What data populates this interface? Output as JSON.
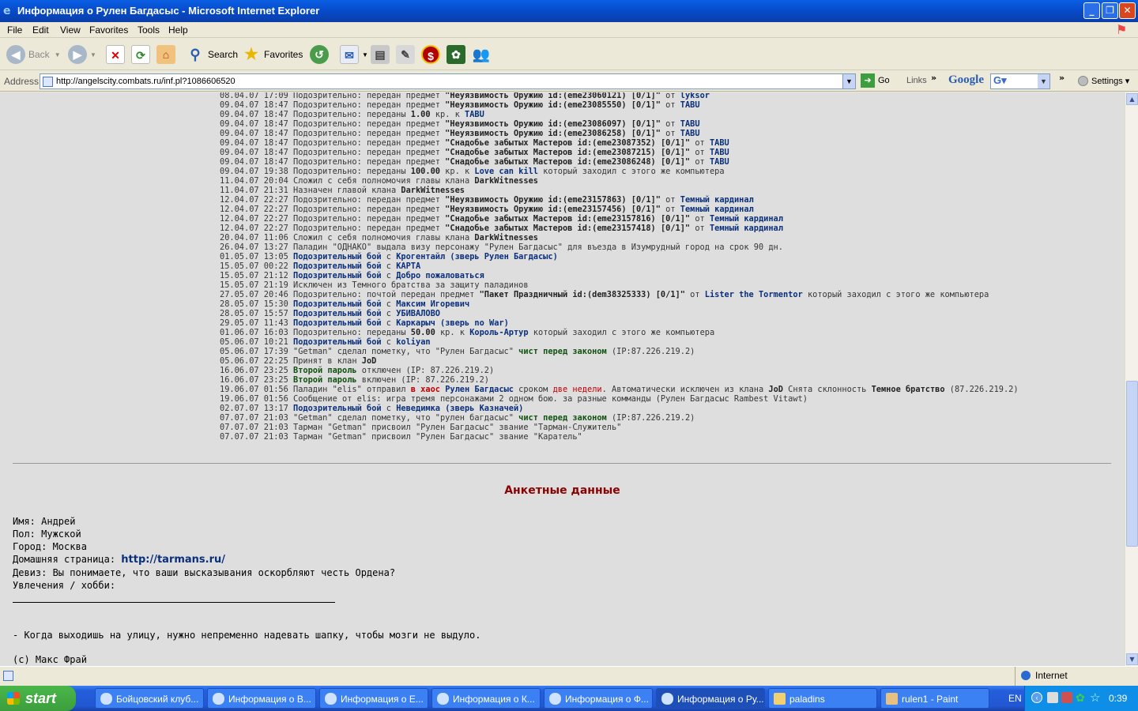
{
  "window": {
    "title": "Информация о Рулен Багдасыс - Microsoft Internet Explorer"
  },
  "menu": [
    "File",
    "Edit",
    "View",
    "Favorites",
    "Tools",
    "Help"
  ],
  "toolbar": {
    "back": "Back",
    "search": "Search",
    "favorites": "Favorites"
  },
  "address": {
    "label": "Address",
    "url": "http://angelscity.combats.ru/inf.pl?1086606520",
    "go": "Go",
    "links": "Links",
    "google": "Google",
    "settings": "Settings"
  },
  "log": [
    [
      [
        "",
        "08.04.07 17:09 Подозрительно: передан предмет "
      ],
      [
        "b",
        "\"Неуязвимость Оружию id:(eme23060121) [0/1]\""
      ],
      [
        "",
        " от "
      ],
      [
        "lk",
        "lyksor"
      ]
    ],
    [
      [
        "",
        "09.04.07 18:47 Подозрительно: передан предмет "
      ],
      [
        "b",
        "\"Неуязвимость Оружию id:(eme23085550) [0/1]\""
      ],
      [
        "",
        " от "
      ],
      [
        "lk",
        "TABU"
      ]
    ],
    [
      [
        "",
        "09.04.07 18:47 Подозрительно: переданы "
      ],
      [
        "b",
        "1.00"
      ],
      [
        "",
        " кр. к "
      ],
      [
        "lk",
        "TABU"
      ]
    ],
    [
      [
        "",
        "09.04.07 18:47 Подозрительно: передан предмет "
      ],
      [
        "b",
        "\"Неуязвимость Оружию id:(eme23086097) [0/1]\""
      ],
      [
        "",
        " от "
      ],
      [
        "lk",
        "TABU"
      ]
    ],
    [
      [
        "",
        "09.04.07 18:47 Подозрительно: передан предмет "
      ],
      [
        "b",
        "\"Неуязвимость Оружию id:(eme23086258) [0/1]\""
      ],
      [
        "",
        " от "
      ],
      [
        "lk",
        "TABU"
      ]
    ],
    [
      [
        "",
        "09.04.07 18:47 Подозрительно: передан предмет "
      ],
      [
        "b",
        "\"Снадобье забытых Мастеров id:(eme23087352) [0/1]\""
      ],
      [
        "",
        " от "
      ],
      [
        "lk",
        "TABU"
      ]
    ],
    [
      [
        "",
        "09.04.07 18:47 Подозрительно: передан предмет "
      ],
      [
        "b",
        "\"Снадобье забытых Мастеров id:(eme23087215) [0/1]\""
      ],
      [
        "",
        " от "
      ],
      [
        "lk",
        "TABU"
      ]
    ],
    [
      [
        "",
        "09.04.07 18:47 Подозрительно: передан предмет "
      ],
      [
        "b",
        "\"Снадобье забытых Мастеров id:(eme23086248) [0/1]\""
      ],
      [
        "",
        " от "
      ],
      [
        "lk",
        "TABU"
      ]
    ],
    [
      [
        "",
        "09.04.07 19:38 Подозрительно: переданы "
      ],
      [
        "b",
        "100.00"
      ],
      [
        "",
        " кр. к "
      ],
      [
        "lk",
        "Love can kill"
      ],
      [
        "",
        " который заходил с этого же компьютера"
      ]
    ],
    [
      [
        "",
        "11.04.07 20:04 Сложил с себя полномочия главы клана "
      ],
      [
        "b",
        "DarkWitnesses"
      ]
    ],
    [
      [
        "",
        "11.04.07 21:31 Назначен главой клана "
      ],
      [
        "b",
        "DarkWitnesses"
      ]
    ],
    [
      [
        "",
        "12.04.07 22:27 Подозрительно: передан предмет "
      ],
      [
        "b",
        "\"Неуязвимость Оружию id:(eme23157863) [0/1]\""
      ],
      [
        "",
        " от "
      ],
      [
        "lk",
        "Темный кардинал"
      ]
    ],
    [
      [
        "",
        "12.04.07 22:27 Подозрительно: передан предмет "
      ],
      [
        "b",
        "\"Неуязвимость Оружию id:(eme23157456) [0/1]\""
      ],
      [
        "",
        " от "
      ],
      [
        "lk",
        "Темный кардинал"
      ]
    ],
    [
      [
        "",
        "12.04.07 22:27 Подозрительно: передан предмет "
      ],
      [
        "b",
        "\"Снадобье забытых Мастеров id:(eme23157816) [0/1]\""
      ],
      [
        "",
        " от "
      ],
      [
        "lk",
        "Темный кардинал"
      ]
    ],
    [
      [
        "",
        "12.04.07 22:27 Подозрительно: передан предмет "
      ],
      [
        "b",
        "\"Снадобье забытых Мастеров id:(eme23157418) [0/1]\""
      ],
      [
        "",
        " от "
      ],
      [
        "lk",
        "Темный кардинал"
      ]
    ],
    [
      [
        "",
        "20.04.07 11:06 Сложил с себя полномочия главы клана "
      ],
      [
        "b",
        "DarkWitnesses"
      ]
    ],
    [
      [
        "",
        "26.04.07 13:27 Паладин \"ОДНАКО\" выдала визу персонажу \"Рулен Багдасыс\" для въезда в Изумрудный город на срок 90 дн."
      ]
    ],
    [
      [
        "",
        "01.05.07 13:05 "
      ],
      [
        "lk",
        "Подозрительный бой"
      ],
      [
        "",
        " с "
      ],
      [
        "lk",
        "Крогентайл (зверь Рулен Багдасыс)"
      ]
    ],
    [
      [
        "",
        "15.05.07 00:22 "
      ],
      [
        "lk",
        "Подозрительный бой"
      ],
      [
        "",
        " с "
      ],
      [
        "lk",
        "КАРТА"
      ]
    ],
    [
      [
        "",
        "15.05.07 21:12 "
      ],
      [
        "lk",
        "Подозрительный бой"
      ],
      [
        "",
        " с "
      ],
      [
        "lk",
        "Добро пожаловаться"
      ]
    ],
    [
      [
        "",
        "15.05.07 21:19 Исключен из Темного братства за защиту паладинов"
      ]
    ],
    [
      [
        "",
        "27.05.07 20:46 Подозрительно: почтой передан предмет "
      ],
      [
        "b",
        "\"Пакет Праздничный id:(dem38325333) [0/1]\""
      ],
      [
        "",
        " от "
      ],
      [
        "lk",
        "Lister the Tormentor"
      ],
      [
        "",
        " который заходил с этого же компьютера"
      ]
    ],
    [
      [
        "",
        "28.05.07 15:30 "
      ],
      [
        "lk",
        "Подозрительный бой"
      ],
      [
        "",
        " с "
      ],
      [
        "lk",
        "Максим Игоревич"
      ]
    ],
    [
      [
        "",
        "28.05.07 15:57 "
      ],
      [
        "lk",
        "Подозрительный бой"
      ],
      [
        "",
        " с "
      ],
      [
        "lk",
        "УБИВАЛОВО"
      ]
    ],
    [
      [
        "",
        "29.05.07 11:43 "
      ],
      [
        "lk",
        "Подозрительный бой"
      ],
      [
        "",
        " с "
      ],
      [
        "lk",
        "Каркарыч (зверь no War)"
      ]
    ],
    [
      [
        "",
        "01.06.07 16:03 Подозрительно: переданы "
      ],
      [
        "b",
        "50.00"
      ],
      [
        "",
        " кр. к "
      ],
      [
        "lk",
        "Король-Артур"
      ],
      [
        "",
        " который заходил с этого же компьютера"
      ]
    ],
    [
      [
        "",
        "05.06.07 10:21 "
      ],
      [
        "lk",
        "Подозрительный бой"
      ],
      [
        "",
        " с "
      ],
      [
        "lk",
        "koliyan"
      ]
    ],
    [
      [
        "",
        "05.06.07 17:39 \"Getman\" сделал пометку, что \"Рулен Багдасыс\" "
      ],
      [
        "g",
        "чист перед законом"
      ],
      [
        "",
        " (IP:87.226.219.2)"
      ]
    ],
    [
      [
        "",
        "05.06.07 22:25 Принят в клан "
      ],
      [
        "b",
        "JoD"
      ]
    ],
    [
      [
        "",
        "16.06.07 23:25 "
      ],
      [
        "g",
        "Второй пароль"
      ],
      [
        "",
        " отключен (IP: 87.226.219.2)"
      ]
    ],
    [
      [
        "",
        "16.06.07 23:25 "
      ],
      [
        "g",
        "Второй пароль"
      ],
      [
        "",
        " включен (IP: 87.226.219.2)"
      ]
    ],
    [
      [
        "",
        "19.06.07 01:56 Паладин \"elis\" отправил "
      ],
      [
        "r",
        "в хаос"
      ],
      [
        "",
        " "
      ],
      [
        "lk",
        "Рулен Багдасыс"
      ],
      [
        "",
        " сроком "
      ],
      [
        "rr",
        "две недели"
      ],
      [
        "",
        ". Автоматически исключен из клана "
      ],
      [
        "b",
        "JoD"
      ],
      [
        "",
        " Снята склонность "
      ],
      [
        "b",
        "Темное братство"
      ],
      [
        "",
        " (87.226.219.2)"
      ]
    ],
    [
      [
        "",
        "19.06.07 01:56 Сообщение от elis: игра тремя персонажами 2 одном бою. за разные комманды (Рулен Багдасыс Rambest Vitawt)"
      ]
    ],
    [
      [
        "",
        "02.07.07 13:17 "
      ],
      [
        "lk",
        "Подозрительный бой"
      ],
      [
        "",
        " с "
      ],
      [
        "lk",
        "Неведимка (зверь Казначей)"
      ]
    ],
    [
      [
        "",
        "07.07.07 21:03 \"Getman\" сделал пометку, что \"рулен багдасыс\" "
      ],
      [
        "g",
        "чист перед законом"
      ],
      [
        "",
        " (IP:87.226.219.2)"
      ]
    ],
    [
      [
        "",
        "07.07.07 21:03 Тарман \"Getman\" присвоил \"Рулен Багдасыс\" звание \"Тарман-Служитель\""
      ]
    ],
    [
      [
        "",
        "07.07.07 21:03 Тарман \"Getman\" присвоил \"Рулен Багдасыс\" звание \"Каратель\""
      ]
    ]
  ],
  "anket": {
    "title": "Анкетные данные",
    "name": "Имя: Андрей",
    "sex": "Пол: Мужской",
    "city": "Город: Москва",
    "home_label": "Домашняя страница: ",
    "home_url": "http://tarmans.ru/",
    "motto": "Девиз: Вы понимаете, что ваши высказывания оскорбляют честь Ордена?",
    "hobby": "Увлечения / хобби:",
    "quote": "- Когда выходишь на улицу, нужно непременно надевать шапку, чтобы мозги не выдуло.",
    "quote_author": "(c) Макс Фрай"
  },
  "status": {
    "zone": "Internet"
  },
  "taskbar": {
    "start": "start",
    "tasks": [
      "Бойцовский клуб...",
      "Информация о В...",
      "Информация о Е...",
      "Информация о К...",
      "Информация о Ф...",
      "Информация о Ру...",
      "paladins",
      "rulen1 - Paint"
    ],
    "lang": "EN",
    "clock": "0:39"
  }
}
